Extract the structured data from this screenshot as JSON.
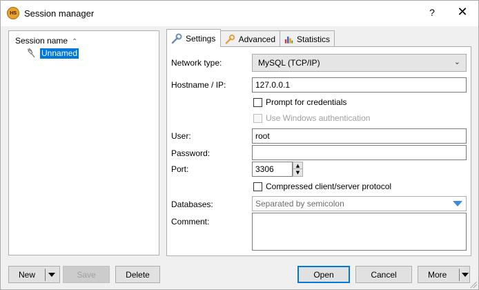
{
  "window": {
    "title": "Session manager",
    "help": "?",
    "close": "✕",
    "app_icon_text": "HS"
  },
  "tree": {
    "header": "Session name",
    "sort_indicator": "^",
    "items": [
      {
        "label": "Unnamed",
        "icon": "plug-icon",
        "selected": true
      }
    ]
  },
  "tabs": [
    {
      "label": "Settings",
      "icon": "wrench-icon",
      "active": true
    },
    {
      "label": "Advanced",
      "icon": "wrench-orange-icon",
      "active": false
    },
    {
      "label": "Statistics",
      "icon": "bar-chart-icon",
      "active": false
    }
  ],
  "settings": {
    "network_type": {
      "label": "Network type:",
      "value": "MySQL (TCP/IP)"
    },
    "hostname": {
      "label": "Hostname / IP:",
      "value": "127.0.0.1"
    },
    "prompt_credentials": {
      "label": "Prompt for credentials",
      "checked": false
    },
    "windows_auth": {
      "label": "Use Windows authentication",
      "checked": false,
      "disabled": true
    },
    "user": {
      "label": "User:",
      "value": "root"
    },
    "password": {
      "label": "Password:",
      "value": ""
    },
    "port": {
      "label": "Port:",
      "value": "3306"
    },
    "compressed": {
      "label": "Compressed client/server protocol",
      "checked": false
    },
    "databases": {
      "label": "Databases:",
      "placeholder": "Separated by semicolon"
    },
    "comment": {
      "label": "Comment:",
      "value": ""
    }
  },
  "buttons": {
    "new": "New",
    "save": "Save",
    "delete": "Delete",
    "open": "Open",
    "cancel": "Cancel",
    "more": "More"
  },
  "colors": {
    "selection": "#0078d7",
    "accent": "#3b8bdb"
  }
}
